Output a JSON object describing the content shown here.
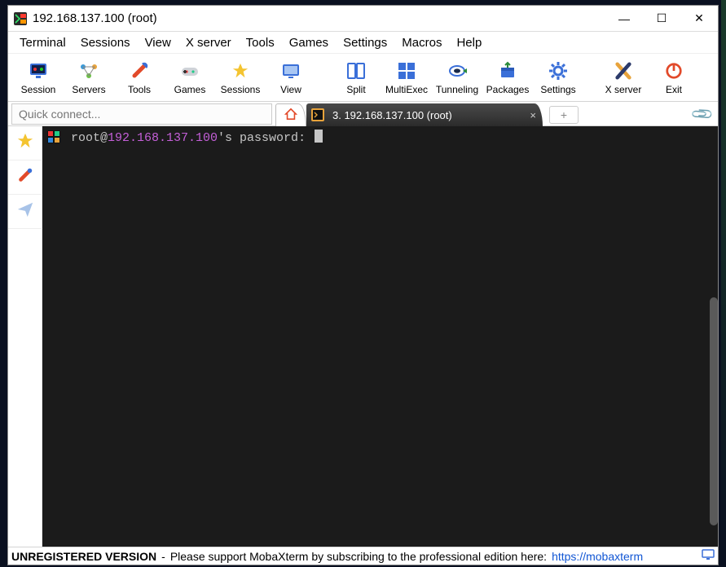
{
  "window": {
    "title": "192.168.137.100 (root)",
    "controls": {
      "minimize": "—",
      "maximize": "☐",
      "close": "✕"
    }
  },
  "menubar": [
    "Terminal",
    "Sessions",
    "View",
    "X server",
    "Tools",
    "Games",
    "Settings",
    "Macros",
    "Help"
  ],
  "toolbar": [
    {
      "id": "session-button",
      "label": "Session"
    },
    {
      "id": "servers-button",
      "label": "Servers"
    },
    {
      "id": "tools-button",
      "label": "Tools"
    },
    {
      "id": "games-button",
      "label": "Games"
    },
    {
      "id": "sessions-button",
      "label": "Sessions"
    },
    {
      "id": "view-button",
      "label": "View"
    },
    {
      "id": "split-button",
      "label": "Split"
    },
    {
      "id": "multiexec-button",
      "label": "MultiExec"
    },
    {
      "id": "tunneling-button",
      "label": "Tunneling"
    },
    {
      "id": "packages-button",
      "label": "Packages"
    },
    {
      "id": "settings-button",
      "label": "Settings"
    },
    {
      "id": "xserver-button",
      "label": "X server"
    },
    {
      "id": "exit-button",
      "label": "Exit"
    }
  ],
  "tabbar": {
    "quick_connect_placeholder": "Quick connect...",
    "session_tab_label": "3. 192.168.137.100 (root)",
    "close_glyph": "×",
    "add_glyph": "+"
  },
  "terminal": {
    "prompt_user_prefix": " root@",
    "prompt_host": "192.168.137.100",
    "prompt_suffix": "'s password: "
  },
  "statusbar": {
    "bold": "UNREGISTERED VERSION",
    "sep": "  -  ",
    "msg": "Please support MobaXterm by subscribing to the professional edition here:  ",
    "link_text": "https://mobaxterm"
  }
}
